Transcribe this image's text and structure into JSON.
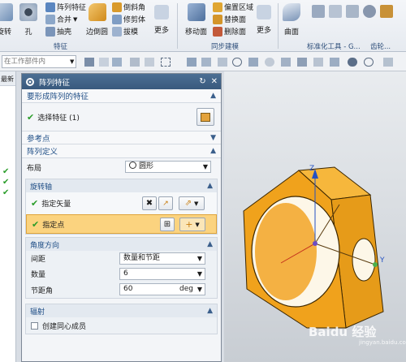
{
  "ribbon": {
    "rotate_label": "旋转",
    "hole_label": "孔",
    "pattern_feature_label": "阵列特征",
    "merge_label": "合并",
    "shell_label": "抽壳",
    "edge_blend_label": "边倒圆",
    "chamfer_label": "倒斜角",
    "trim_body_label": "修剪体",
    "draft_label": "拔模",
    "more_label_1": "更多",
    "move_face_label": "移动面",
    "offset_region_label": "偏置区域",
    "replace_face_label": "替换面",
    "delete_face_label": "删除面",
    "more_label_2": "更多",
    "surface_label": "曲面",
    "group_feature": "特征",
    "group_sync": "同步建模",
    "group_std_tools": "标准化工具 - G...",
    "group_gear": "齿轮..."
  },
  "selbar": {
    "filter_placeholder": "在工作部件内"
  },
  "leftstrip": {
    "header": "最新"
  },
  "dialog": {
    "title": "阵列特征",
    "sec_features": "要形成阵列的特征",
    "select_feature": "选择特征 (1)",
    "sec_ref_point": "参考点",
    "sec_pattern_def": "阵列定义",
    "layout_label": "布局",
    "layout_value": "圆形",
    "rotation_axis": "旋转轴",
    "specify_vector": "指定矢量",
    "specify_point": "指定点",
    "angular_direction": "角度方向",
    "spacing_label": "间距",
    "spacing_value": "数量和节距",
    "count_label": "数量",
    "count_value": "6",
    "pitch_label": "节距角",
    "pitch_value": "60",
    "pitch_unit": "deg",
    "radiate": "辐射",
    "create_concentric": "创建同心成员"
  },
  "viewport": {
    "axis_z": "Z",
    "axis_y": "Y",
    "watermark": "Baidu 经验",
    "watermark_url": "jingyan.baidu.com"
  },
  "colors": {
    "accent": "#39597d",
    "part_orange": "#f0a21c",
    "check_green": "#2a9d2a"
  }
}
